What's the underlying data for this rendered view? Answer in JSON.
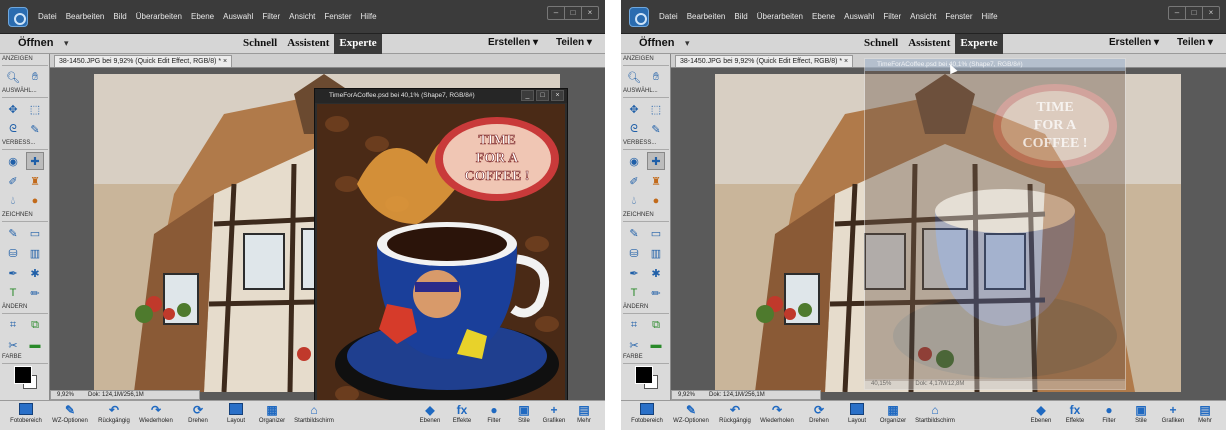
{
  "menu": {
    "items": [
      "Datei",
      "Bearbeiten",
      "Bild",
      "Überarbeiten",
      "Ebene",
      "Auswahl",
      "Filter",
      "Ansicht",
      "Fenster",
      "Hilfe"
    ],
    "window_controls": [
      "–",
      "□",
      "×"
    ]
  },
  "modebar": {
    "open": "Öffnen",
    "caret": "▾",
    "modes": [
      "Schnell",
      "Assistent",
      "Experte"
    ],
    "create": "Erstellen ▾",
    "share": "Teilen ▾"
  },
  "document_tab": "38-1450.JPG bei 9,92% (Quick Edit Effect, RGB/8) * ×",
  "toolbox": {
    "sections": [
      "ANZEIGEN",
      "AUSWÄHL...",
      "VERBESS...",
      "ZEICHNEN",
      "ÄNDERN",
      "FARBE"
    ]
  },
  "status": {
    "zoom": "9,92%",
    "doc_size": "Dok: 124,1M/256,1M"
  },
  "float_window": {
    "title": "TimeForACoffee.psd bei 40,1% (Shape7, RGB/8#)",
    "controls": [
      "_",
      "□",
      "×"
    ],
    "zoom": "40,15%",
    "doc_size": "Dok: 4,17M/12,8M"
  },
  "coffee_sign": [
    "TIME",
    "FOR A",
    "COFFEE !"
  ],
  "taskbar": {
    "left_items": [
      "Fotobereich",
      "WZ-Optionen",
      "Rückgängig",
      "Wiederholen",
      "Drehen",
      "Layout",
      "Organizer",
      "Startbildschirm"
    ],
    "right_items": [
      "Ebenen",
      "Effekte",
      "Filter",
      "Stile",
      "Grafiken",
      "Mehr"
    ],
    "right_icons": [
      "◆",
      "fx",
      "●",
      "▣",
      "+",
      "▤"
    ]
  },
  "colors": {
    "accent": "#2a6cb0",
    "menubar": "#3b3b3b",
    "active_mode": "#3a3a3a",
    "badge_red": "#c0392b"
  }
}
